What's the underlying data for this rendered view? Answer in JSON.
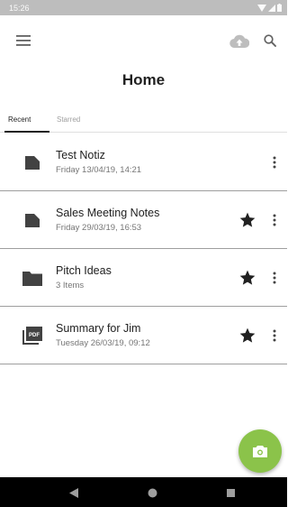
{
  "status_bar": {
    "time": "15:26"
  },
  "header": {
    "title": "Home"
  },
  "tabs": [
    {
      "label": "Recent",
      "selected": true
    },
    {
      "label": "Starred",
      "selected": false
    }
  ],
  "files": [
    {
      "name": "Test Notiz",
      "meta": "Friday 13/04/19, 14:21",
      "icon": "note-icon",
      "starred": false
    },
    {
      "name": "Sales Meeting Notes",
      "meta": "Friday 29/03/19, 16:53",
      "icon": "note-icon",
      "starred": true
    },
    {
      "name": "Pitch Ideas",
      "meta": "3 Items",
      "icon": "folder-icon",
      "starred": true
    },
    {
      "name": "Summary for Jim",
      "meta": "Tuesday 26/03/19, 09:12",
      "icon": "pdf-icon",
      "pdf_badge": "PDF",
      "starred": true
    }
  ],
  "colors": {
    "fab": "#8bc34a",
    "status_bar": "#bdbdbd",
    "nav_bar": "#000000",
    "divider": "#9e9e9e"
  }
}
